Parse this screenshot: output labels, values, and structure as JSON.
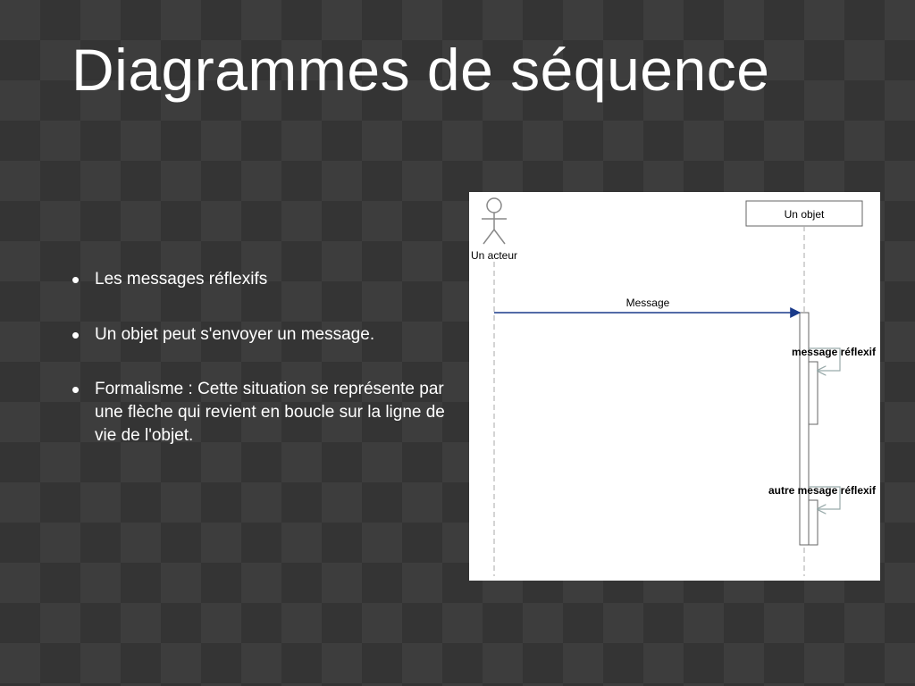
{
  "title": "Diagrammes de séquence",
  "bullets": [
    "Les messages réflexifs",
    "Un objet peut s'envoyer un message.",
    "Formalisme : Cette situation se représente par une flèche qui revient en boucle sur la ligne de vie de l'objet."
  ],
  "diagram": {
    "actor_label": "Un acteur",
    "object_label": "Un objet",
    "message_label": "Message",
    "reflexive_label": "message réflexif",
    "other_reflexive_label": "autre mesage réflexif"
  }
}
